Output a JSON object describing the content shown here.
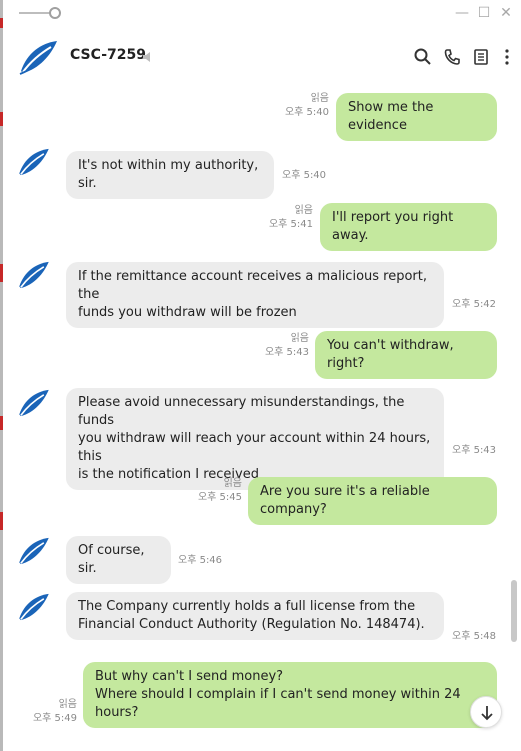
{
  "window": {
    "minimize_glyph": "—",
    "maximize_glyph": "☐",
    "close_glyph": "✕"
  },
  "header": {
    "title": "CSC-7259",
    "icons": [
      "search-icon",
      "phone-icon",
      "menu-list-icon",
      "more-icon"
    ]
  },
  "colors": {
    "outgoing_bubble": "#c4e89e",
    "incoming_bubble": "#ececec",
    "logo_blue": "#1a64b8"
  },
  "messages": [
    {
      "dir": "out",
      "text": "Show me the evidence",
      "read": "읽음",
      "time": "오후 5:40"
    },
    {
      "dir": "in",
      "text": "It's not within my authority, sir.",
      "time": "오후 5:40"
    },
    {
      "dir": "out",
      "text": "I'll report you right away.",
      "read": "읽음",
      "time": "오후 5:41"
    },
    {
      "dir": "in",
      "text": "If the remittance account receives a malicious report, the\nfunds you withdraw will be frozen",
      "time": "오후 5:42"
    },
    {
      "dir": "out",
      "text": "You can't withdraw, right?",
      "read": "읽음",
      "time": "오후 5:43"
    },
    {
      "dir": "in",
      "text": "Please avoid unnecessary misunderstandings, the funds\nyou withdraw will reach your account within 24 hours, this\nis the notification I received",
      "time": "오후 5:43"
    },
    {
      "dir": "out",
      "text": "Are you sure it's a reliable company?",
      "read": "읽음",
      "time": "오후 5:45"
    },
    {
      "dir": "in",
      "text": "Of course, sir.",
      "time": "오후 5:46"
    },
    {
      "dir": "in",
      "text": "The Company currently holds a full license from the\nFinancial Conduct Authority (Regulation No. 148474).",
      "time": "오후 5:48"
    },
    {
      "dir": "out",
      "text": "But why can't I send money?\nWhere should I complain if I can't send money within 24\nhours?",
      "read": "읽음",
      "time": "오후 5:49"
    }
  ]
}
